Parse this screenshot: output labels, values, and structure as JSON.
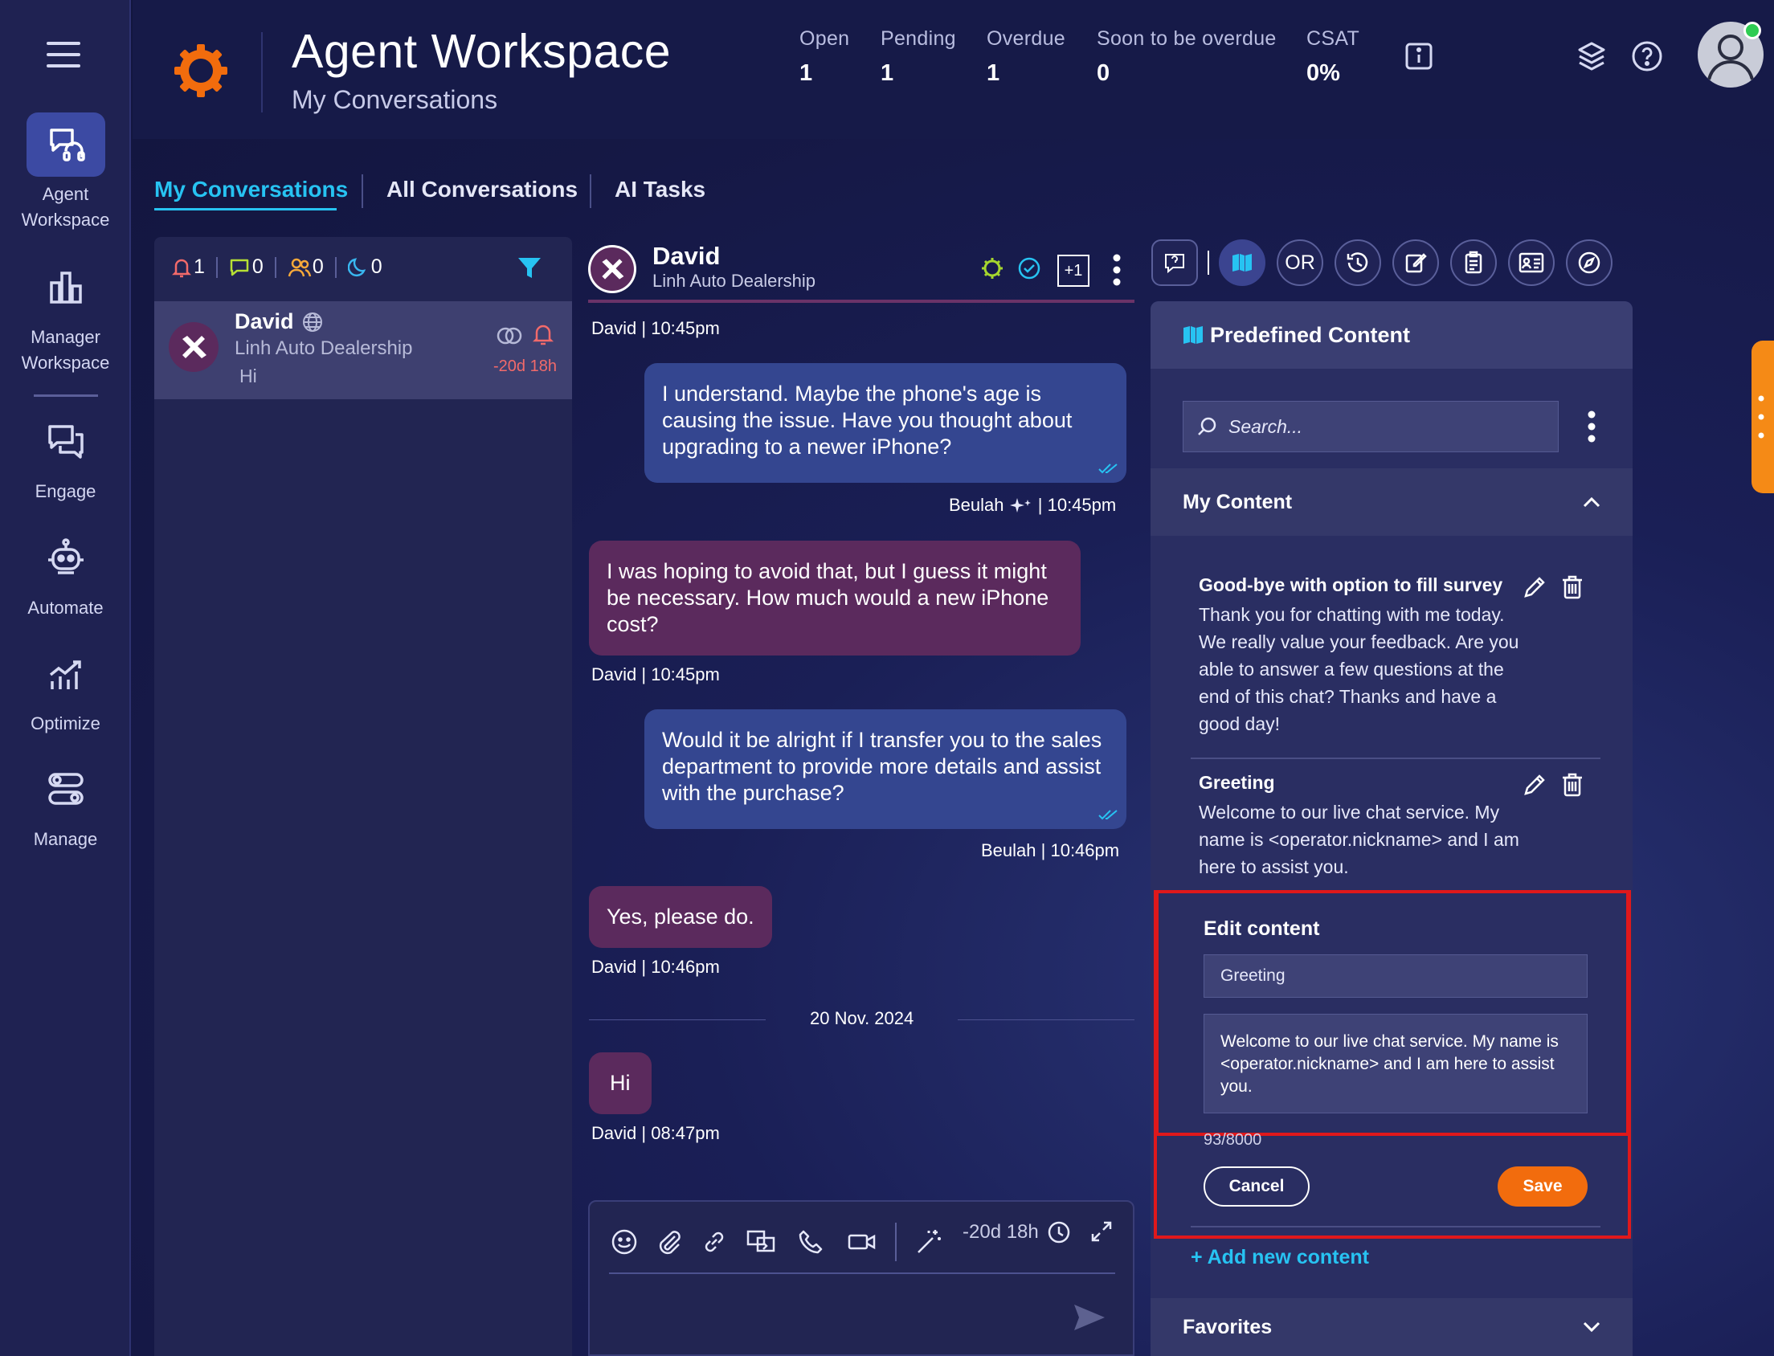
{
  "header": {
    "title": "Agent Workspace",
    "subtitle": "My Conversations",
    "stats": [
      {
        "label": "Open",
        "value": "1"
      },
      {
        "label": "Pending",
        "value": "1"
      },
      {
        "label": "Overdue",
        "value": "1"
      },
      {
        "label": "Soon to be overdue",
        "value": "0"
      },
      {
        "label": "CSAT",
        "value": "0%"
      }
    ]
  },
  "sidebar": {
    "items": [
      {
        "label1": "Agent",
        "label2": "Workspace"
      },
      {
        "label1": "Manager",
        "label2": "Workspace"
      },
      {
        "label1": "Engage"
      },
      {
        "label1": "Automate"
      },
      {
        "label1": "Optimize"
      },
      {
        "label1": "Manage"
      }
    ]
  },
  "tabs": [
    "My Conversations",
    "All Conversations",
    "AI Tasks"
  ],
  "conv_list": {
    "counts": [
      "1",
      "0",
      "0",
      "0"
    ],
    "item": {
      "name": "David",
      "company": "Linh Auto Dealership",
      "preview": "Hi",
      "time": "-20d 18h"
    }
  },
  "chat": {
    "name": "David",
    "company": "Linh Auto Dealership",
    "badge": "+1",
    "messages": [
      {
        "meta_name": "David",
        "meta_time": "10:45pm"
      },
      {
        "text": "I understand. Maybe the phone's age is causing the issue. Have you thought about upgrading to a newer iPhone?",
        "meta_name": "Beulah",
        "meta_time": "10:45pm"
      },
      {
        "text": "I was hoping to avoid that, but I guess it might be necessary. How much would a new iPhone cost?",
        "meta_name": "David",
        "meta_time": "10:45pm"
      },
      {
        "text": "Would it be alright if I transfer you to the sales department to provide more details and assist with the purchase?",
        "meta_name": "Beulah",
        "meta_time": "10:46pm"
      },
      {
        "text": "Yes, please do.",
        "meta_name": "David",
        "meta_time": "10:46pm"
      },
      {
        "text": "Hi",
        "meta_name": "David",
        "meta_time": "08:47pm"
      }
    ],
    "date_divider": "20 Nov. 2024",
    "composer_timer": "-20d 18h"
  },
  "right_panel": {
    "toolbar_or": "OR",
    "title": "Predefined Content",
    "search_placeholder": "Search...",
    "section": "My Content",
    "items": [
      {
        "title": "Good-bye with option to fill survey",
        "text": "Thank you for chatting with me today. We really value your feedback. Are you able to answer a few questions at the end of this chat? Thanks and have a good day!"
      },
      {
        "title": "Greeting",
        "text": "Welcome to our live chat service. My name is <operator.nickname> and I am here to assist you."
      }
    ],
    "edit": {
      "heading": "Edit content",
      "title_value": "Greeting",
      "body_value": "Welcome to our live chat service. My name is <operator.nickname> and I am here to assist you.",
      "counter": "93/8000",
      "cancel": "Cancel",
      "save": "Save"
    },
    "add_new": "+ Add new content",
    "favorites": "Favorites"
  },
  "colors": {
    "accent_orange": "#f26c0d",
    "accent_cyan": "#27c3f2",
    "highlight_red": "#e0181b"
  }
}
